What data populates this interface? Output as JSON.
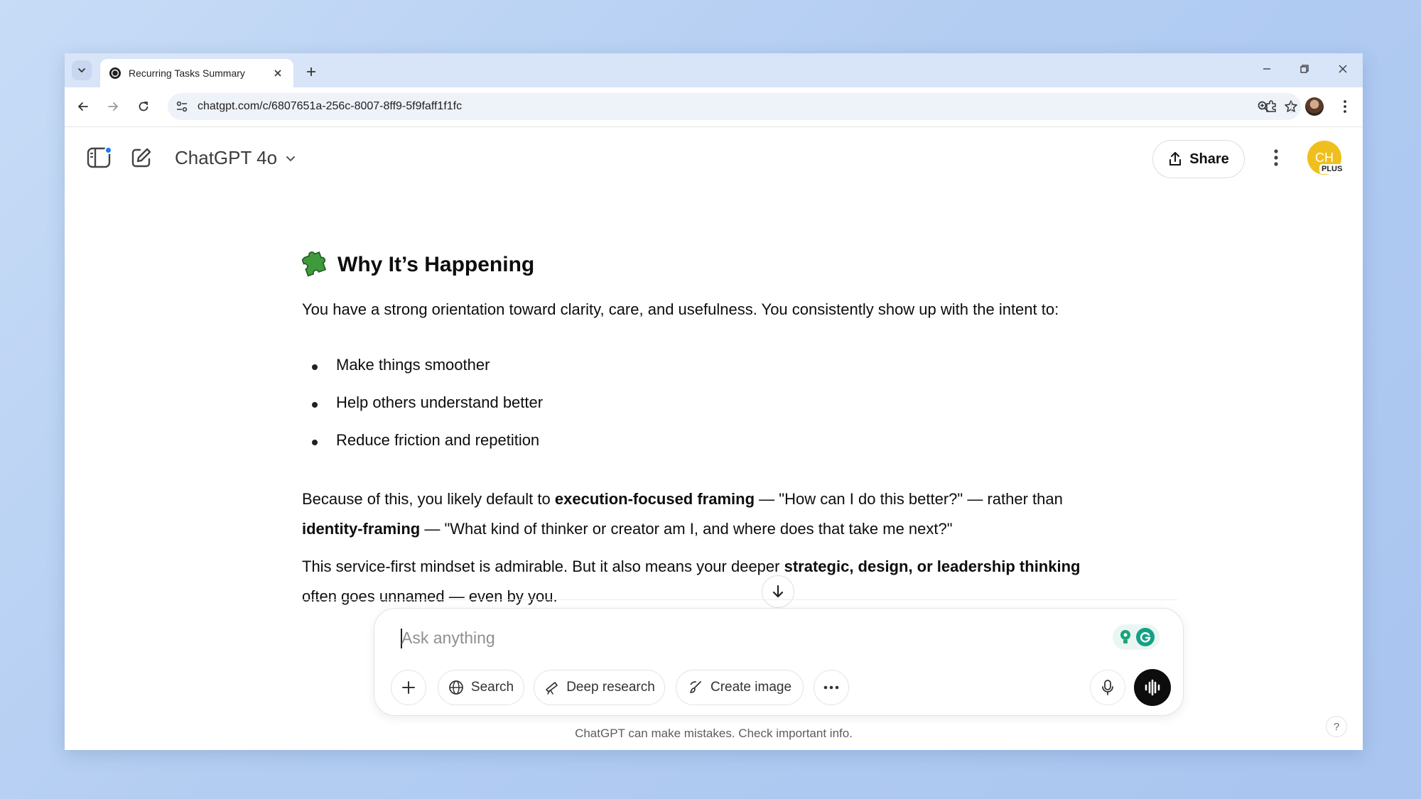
{
  "browser": {
    "tab_title": "Recurring Tasks Summary",
    "url": "chatgpt.com/c/6807651a-256c-8007-8ff9-5f9faff1f1fc"
  },
  "app": {
    "model_label": "ChatGPT 4o",
    "share_label": "Share",
    "avatar_initials": "CH",
    "plan_badge": "PLUS"
  },
  "message": {
    "heading": "Why It’s Happening",
    "intro": "You have a strong orientation toward clarity, care, and usefulness. You consistently show up with the intent to:",
    "bullets": [
      "Make things smoother",
      "Help others understand better",
      "Reduce friction and repetition"
    ],
    "p2": {
      "a": "Because of this, you likely default to ",
      "b1": "execution-focused framing",
      "c": " — \"How can I do this better?\" — rather than ",
      "b2": "identity-framing",
      "d": " — \"What kind of thinker or creator am I, and where does that take me next?\""
    },
    "p3": {
      "a": "This service-first mindset is admirable. But it also means your deeper ",
      "b1": "strategic, design, or leadership thinking",
      "c": " often goes unnamed — even by you."
    }
  },
  "composer": {
    "placeholder": "Ask anything",
    "search_label": "Search",
    "deep_research_label": "Deep research",
    "create_image_label": "Create image"
  },
  "footer": {
    "disclaimer": "ChatGPT can make mistakes. Check important info.",
    "help": "?"
  },
  "colors": {
    "accent_dot": "#1a7cf5",
    "avatar": "#efbf1d",
    "puzzle": "#3f9a3d"
  }
}
